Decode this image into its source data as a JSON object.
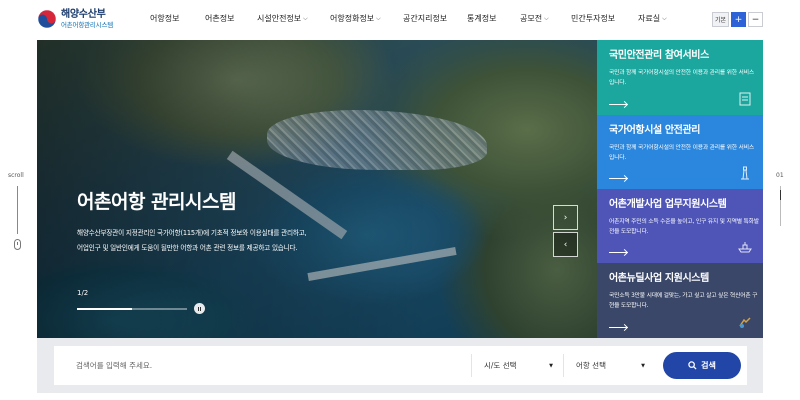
{
  "header": {
    "logo_main": "해양수산부",
    "logo_sub": "어촌어항관리시스템",
    "nav": [
      {
        "label": "어항정보",
        "dropdown": false
      },
      {
        "label": "어촌정보",
        "dropdown": false
      },
      {
        "label": "시설안전정보",
        "dropdown": true
      },
      {
        "label": "어항정화정보",
        "dropdown": true
      },
      {
        "label": "공간지리정보",
        "dropdown": false
      },
      {
        "label": "통계정보",
        "dropdown": false
      },
      {
        "label": "공모전",
        "dropdown": true
      },
      {
        "label": "민간투자정보",
        "dropdown": false
      },
      {
        "label": "자료실",
        "dropdown": true
      }
    ],
    "font_basic": "기본",
    "font_plus": "+",
    "font_minus": "−"
  },
  "side": {
    "scroll_label": "scroll",
    "page_number": "01"
  },
  "hero": {
    "title": "어촌어항 관리시스템",
    "description": "해양수산부장관이 지정관리인 국가어항(115개)에 기초적 정보와 이용실태를 관리하고, 어업인구 및 일반인에게 도움이 될만한 어항과 어촌 관련 정보를 제공하고 있습니다.",
    "counter": "1/2",
    "progress": 0.5
  },
  "panels": [
    {
      "title": "국민안전관리 참여서비스",
      "desc": "국민과 함께 국가어항시설의 안전한 이용과 관리를 위한 서비스 입니다.",
      "color": "#1ba69e",
      "icon": "document-icon"
    },
    {
      "title": "국가어항시설 안전관리",
      "desc": "국민과 함께 국가어항시설의 안전한 이용과 관리를 위한 서비스 입니다.",
      "color": "#2b86dd",
      "icon": "lighthouse-icon"
    },
    {
      "title": "어촌개발사업 업무지원시스템",
      "desc": "어촌지역 주민의 소득 수준을 높이고, 인구 유지 및 지역별 특화발전을 도모합니다.",
      "color": "#4e55b7",
      "icon": "ship-icon"
    },
    {
      "title": "어촌뉴딜사업 지원시스템",
      "desc": "국민소득 3만불 시대에 걸맞는, 가고 싶고 살고 싶은 혁신어촌 구현을 도모합니다.",
      "color": "#3a4769",
      "icon": "hands-icon"
    }
  ],
  "search": {
    "placeholder": "검색어를 입력해 주세요.",
    "sido_select": "시/도 선택",
    "port_select": "어항 선택",
    "button": "검색"
  }
}
